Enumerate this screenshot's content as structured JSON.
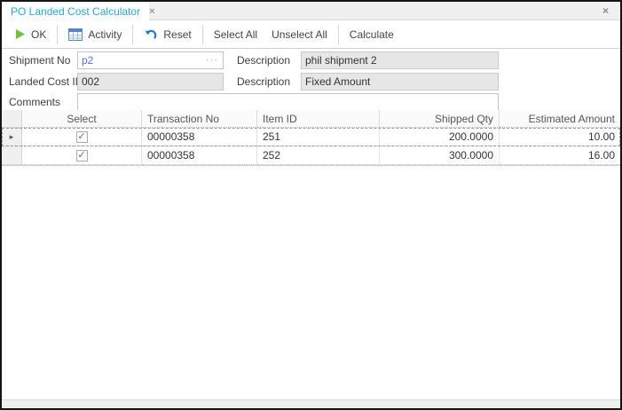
{
  "tab": {
    "title": "PO Landed Cost Calculator",
    "close_glyph": "×"
  },
  "window": {
    "close_glyph": "×"
  },
  "toolbar": {
    "ok_label": "OK",
    "activity_label": "Activity",
    "reset_label": "Reset",
    "select_all_label": "Select All",
    "unselect_all_label": "Unselect All",
    "calculate_label": "Calculate"
  },
  "form": {
    "shipment_no": {
      "label": "Shipment No",
      "value": "p2",
      "lookup_glyph": "···"
    },
    "description1": {
      "label": "Description",
      "value": "phil shipment 2"
    },
    "landed_cost_id": {
      "label": "Landed Cost ID",
      "value": "002"
    },
    "description2": {
      "label": "Description",
      "value": "Fixed Amount"
    },
    "comments": {
      "label": "Comments",
      "value": ""
    }
  },
  "grid": {
    "columns": [
      "Select",
      "Transaction No",
      "Item ID",
      "Shipped Qty",
      "Estimated Amount"
    ],
    "rows": [
      {
        "selected": true,
        "transaction_no": "00000358",
        "item_id": "251",
        "shipped_qty": "200.0000",
        "estimated_amount": "10.00"
      },
      {
        "selected": true,
        "transaction_no": "00000358",
        "item_id": "252",
        "shipped_qty": "300.0000",
        "estimated_amount": "16.00"
      }
    ],
    "focused_row_indicator": "▸"
  },
  "colors": {
    "tab_accent": "#29a5dc",
    "edited_value_blue": "#5a6fe0",
    "ok_green": "#72be44",
    "icon_blue": "#2e79c0"
  }
}
